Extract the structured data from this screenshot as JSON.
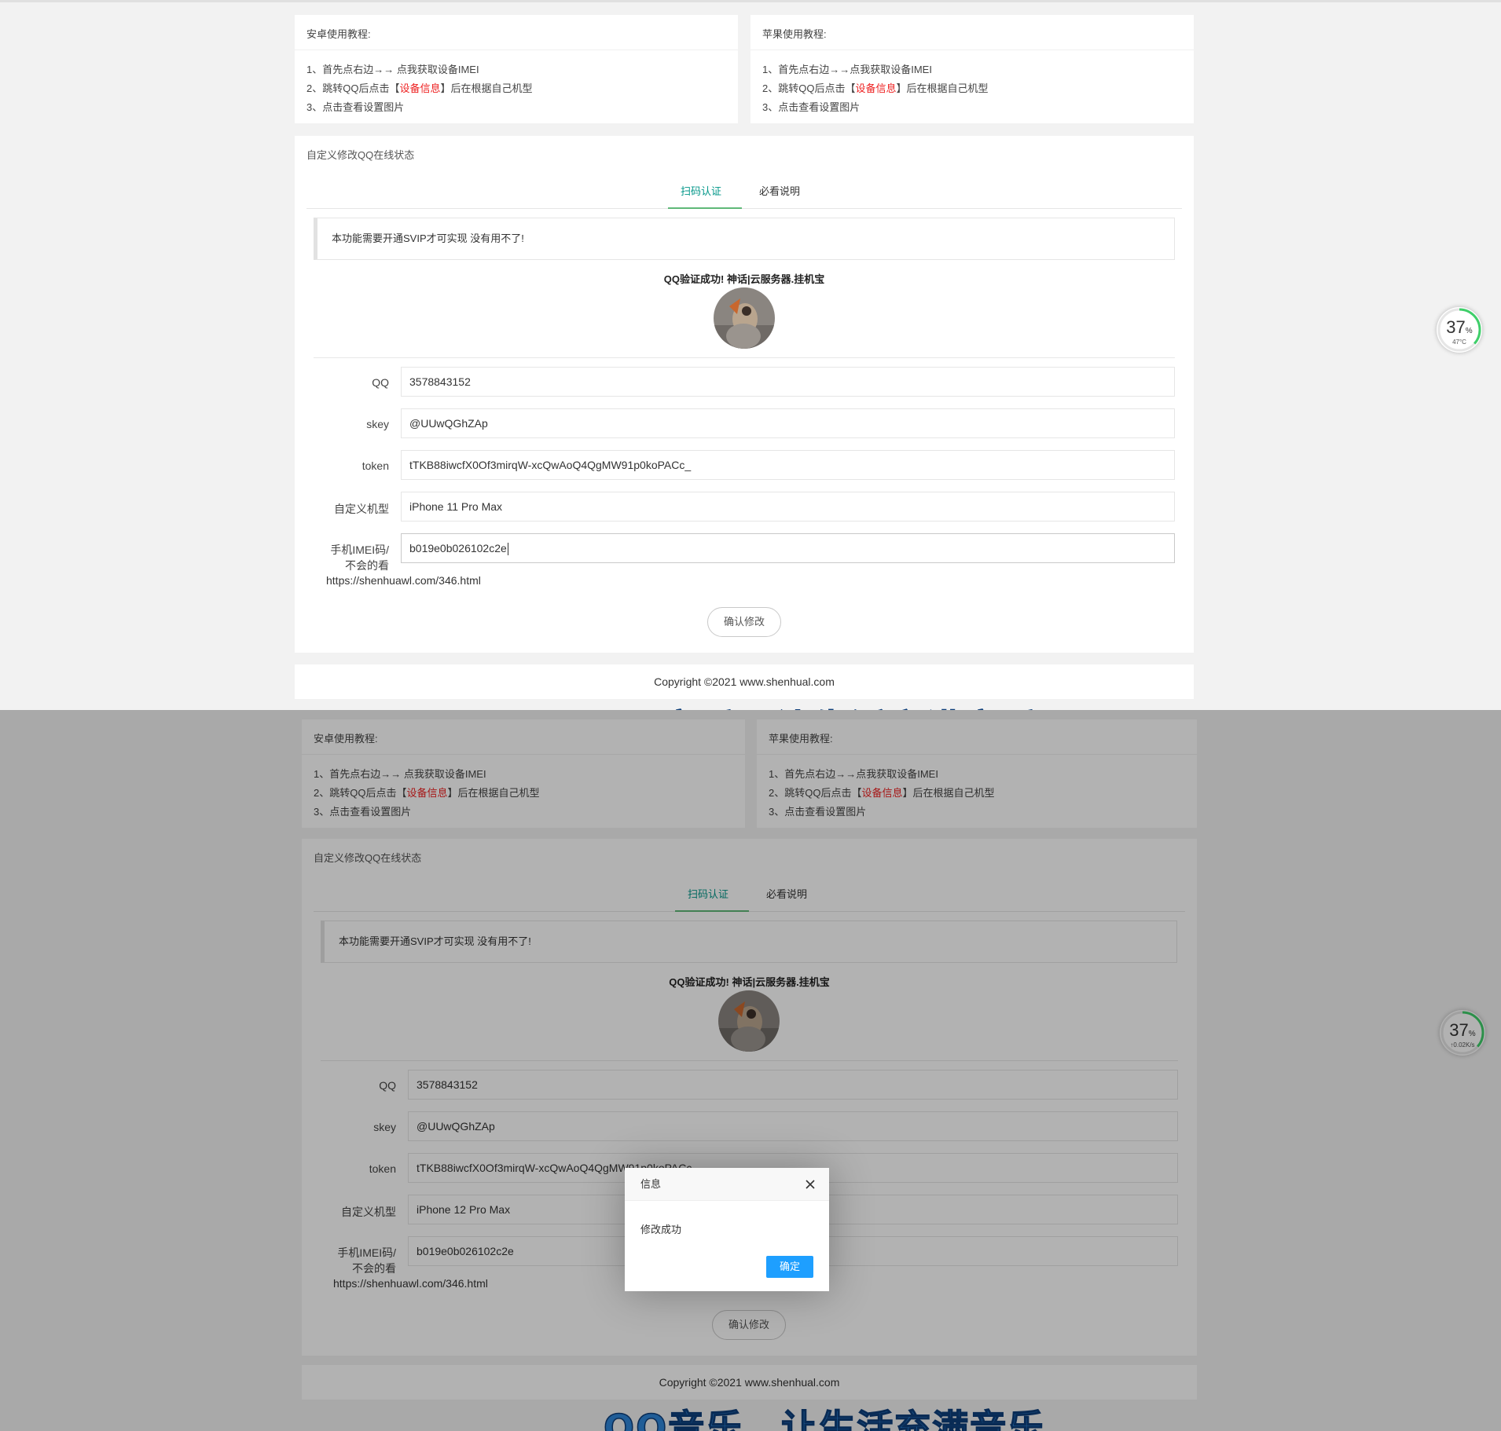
{
  "android_card": {
    "title": "安卓使用教程:",
    "step1": "1、首先点右边→→ 点我获取设备IMEI",
    "step2_pre": "2、跳转QQ后点击【",
    "step2_red": "设备信息",
    "step2_post": "】后在根据自己机型",
    "step3": "3、点击查看设置图片"
  },
  "apple_card": {
    "title": "苹果使用教程:",
    "step1": "1、首先点右边→→点我获取设备IMEI",
    "step2_pre": "2、跳转QQ后点击【",
    "step2_red": "设备信息",
    "step2_post": "】后在根据自己机型",
    "step3": "3、点击查看设置图片"
  },
  "section_title": "自定义修改QQ在线状态",
  "tabs": {
    "scan": "扫码认证",
    "notes": "必看说明"
  },
  "notice": "本功能需要开通SVIP才可实现 没有用不了!",
  "verified_text": "QQ验证成功! 神话|云服务器.挂机宝",
  "form": {
    "qq_label": "QQ",
    "qq_value": "3578843152",
    "skey_label": "skey",
    "skey_value": "@UUwQGhZAp",
    "token_label": "token",
    "token_value": "tTKB88iwcfX0Of3mirqW-xcQwAoQ4QgMW91p0koPACc_",
    "model_label": "自定义机型",
    "model_value_before": "iPhone 11 Pro Max",
    "model_value_after": "iPhone 12 Pro Max",
    "imei_label_1": "手机IMEI码/",
    "imei_label_2": "不会的看",
    "imei_value": "b019e0b026102c2e",
    "help_url": "https://shenhuawl.com/346.html",
    "submit": "确认修改"
  },
  "footer": "Copyright ©2021 www.shenhual.com",
  "banner": "QQ音乐，让生活充满音乐",
  "gauge_1": {
    "percent": "37",
    "unit": "%",
    "sub": "47°C"
  },
  "gauge_2": {
    "percent": "37",
    "unit": "%",
    "sub": "↑0.02K/s"
  },
  "dialog": {
    "title": "信息",
    "message": "修改成功",
    "ok": "确定"
  },
  "colors": {
    "accent": "#009688",
    "tab_underline": "#5FB878",
    "ok_button": "#1E9FFF",
    "red": "#e22222",
    "gauge_ring": "#3fcf6a"
  }
}
